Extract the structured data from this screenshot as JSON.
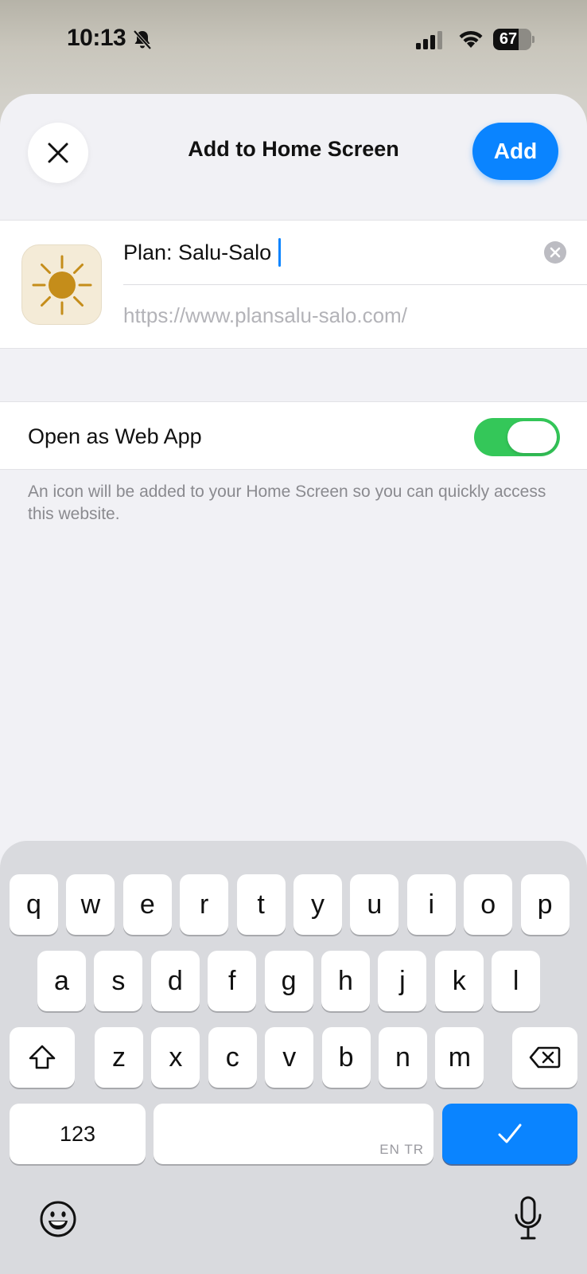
{
  "status_bar": {
    "time": "10:13",
    "battery_level": "67",
    "battery_fraction": 0.67,
    "icons": [
      "bell-slash-icon",
      "cellular-signal-icon",
      "wifi-icon",
      "battery-icon"
    ]
  },
  "sheet": {
    "title": "Add to Home Screen",
    "add_label": "Add",
    "close_icon": "close-icon"
  },
  "bookmark": {
    "name_value": "Plan: Salu-Salo",
    "url": "https://www.plansalu-salo.com/",
    "app_icon": "sun-icon",
    "clear_icon": "clear-text-icon"
  },
  "web_app": {
    "label": "Open as Web App",
    "enabled": true,
    "footnote": "An icon will be added to your Home Screen so you can quickly access this website."
  },
  "keyboard": {
    "row1": [
      "q",
      "w",
      "e",
      "r",
      "t",
      "y",
      "u",
      "i",
      "o",
      "p"
    ],
    "row2": [
      "a",
      "s",
      "d",
      "f",
      "g",
      "h",
      "j",
      "k",
      "l"
    ],
    "row3": [
      "z",
      "x",
      "c",
      "v",
      "b",
      "n",
      "m"
    ],
    "numbers_label": "123",
    "space_language": "EN TR",
    "done_icon": "checkmark-icon",
    "shift_icon": "shift-icon",
    "delete_icon": "delete-icon",
    "emoji_icon": "emoji-icon",
    "mic_icon": "microphone-icon"
  },
  "colors": {
    "accent": "#0a84ff",
    "toggle_on": "#34c759",
    "sheet_background": "#f1f1f5",
    "keyboard_background": "#d9dade"
  }
}
